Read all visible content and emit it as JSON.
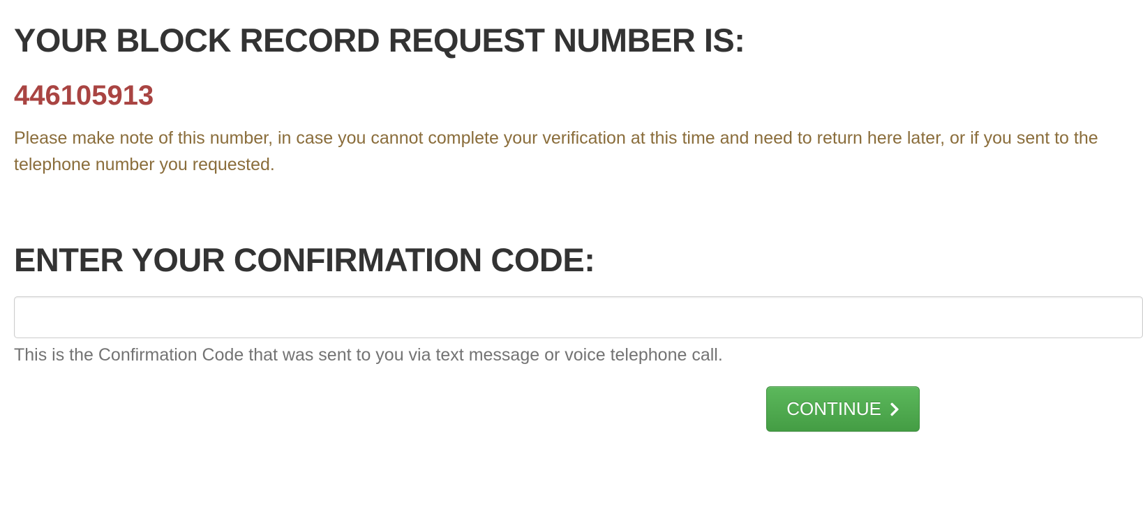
{
  "block_record": {
    "heading": "YOUR BLOCK RECORD REQUEST NUMBER IS:",
    "request_number": "446105913",
    "note": "Please make note of this number, in case you cannot complete your verification at this time and need to return here later, or if you sent to the telephone number you requested."
  },
  "confirmation": {
    "heading": "ENTER YOUR CONFIRMATION CODE:",
    "input_value": "",
    "helper": "This is the Confirmation Code that was sent to you via text message or voice telephone call."
  },
  "actions": {
    "continue_label": "CONTINUE"
  }
}
